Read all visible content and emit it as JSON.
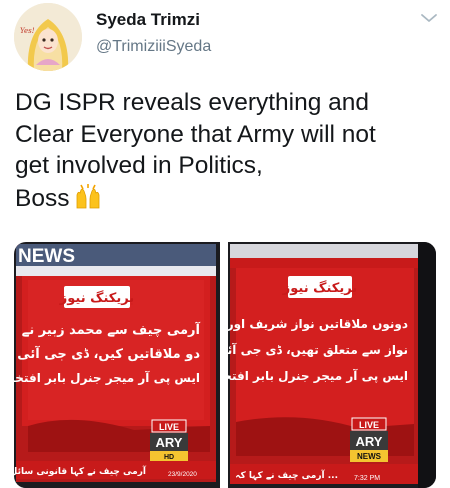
{
  "author": {
    "name": "Syeda Trimzi",
    "handle": "@TrimiziiiSyeda"
  },
  "tweet": {
    "lines": [
      "DG ISPR reveals everything and",
      "Clear Everyone that Army will not",
      "get involved in Politics,",
      "Boss"
    ],
    "emoji": "raising-hands"
  },
  "media": {
    "left_photo": {
      "corner_text": "NEWS",
      "breaking_label": "بریکنگ نیوز",
      "lines": [
        "آرمی چیف سے محمد زبیر نے",
        "دو ملاقاتیں کیں، ڈی جی آئی",
        "ایس پی آر میجر جنرل بابر افتخار"
      ],
      "live_label": "LIVE",
      "channel": "ARY",
      "sub_logo": "HD",
      "ticker": "آرمی چیف نے کہا قانونی سائل عدالتوں میں",
      "date": "23/9/2020"
    },
    "right_photo": {
      "breaking_label": "بریکنگ نیوز",
      "lines": [
        "دونوں ملاقاتیں نواز شریف اور مریم",
        "نواز سے متعلق تھیں، ڈی جی آئی",
        "ایس پی آر میجر جنرل بابر افتخار"
      ],
      "live_label": "LIVE",
      "channel": "ARY",
      "sub_logo": "NEWS",
      "ticker": "آرمی چیف نے کہا کہ ...",
      "time": "7:32 PM"
    }
  },
  "colors": {
    "red": "#d31f1f",
    "dark_red": "#9e1212",
    "gold": "#f4c430",
    "muted": "#657786"
  }
}
